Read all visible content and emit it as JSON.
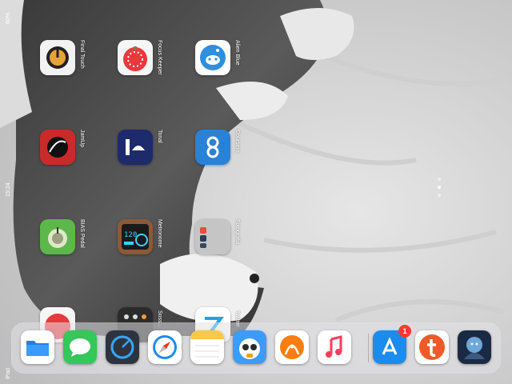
{
  "status": {
    "device": "iPad",
    "time": "15:24",
    "battery": "60%"
  },
  "home_apps": [
    {
      "label": "Final Touch",
      "icon": "final-touch-icon"
    },
    {
      "label": "Focus Keeper",
      "icon": "focus-keeper-icon"
    },
    {
      "label": "Alien Blue",
      "icon": "alien-blue-icon"
    },
    {
      "label": "JamUp",
      "icon": "jamup-icon"
    },
    {
      "label": "Tonal",
      "icon": "tonal-icon"
    },
    {
      "label": "Coursera",
      "icon": "coursera-icon"
    },
    {
      "label": "BIAS Pedal",
      "icon": "bias-pedal-icon"
    },
    {
      "label": "Metronome",
      "icon": "metronome-icon"
    },
    {
      "label": "Fotografia",
      "icon": "folder-icon"
    }
  ],
  "partial_row": [
    {
      "label": "",
      "icon": "red-app-icon"
    },
    {
      "label": "Soss...",
      "icon": "calculator-icon"
    },
    {
      "label": "Twitter",
      "icon": "twitter-like-icon"
    }
  ],
  "page_dots": 3,
  "active_page": 1,
  "dock": {
    "apps": [
      {
        "name": "Files",
        "icon": "files-icon"
      },
      {
        "name": "Messages",
        "icon": "messages-icon"
      },
      {
        "name": "Speedometer",
        "icon": "speedometer-icon"
      },
      {
        "name": "Safari",
        "icon": "safari-icon"
      },
      {
        "name": "Notes",
        "icon": "notes-icon"
      },
      {
        "name": "Tweetbot",
        "icon": "tweetbot-icon"
      },
      {
        "name": "Overcast",
        "icon": "overcast-icon"
      },
      {
        "name": "Music",
        "icon": "music-icon"
      }
    ],
    "recent_apps": [
      {
        "name": "App Store",
        "icon": "app-store-icon",
        "badge": "1"
      },
      {
        "name": "Tumblr",
        "icon": "tumblr-icon"
      },
      {
        "name": "Game",
        "icon": "game-icon"
      }
    ]
  },
  "colors": {
    "badge": "#ff3b30",
    "dock_bg": "#e1e1e6"
  }
}
